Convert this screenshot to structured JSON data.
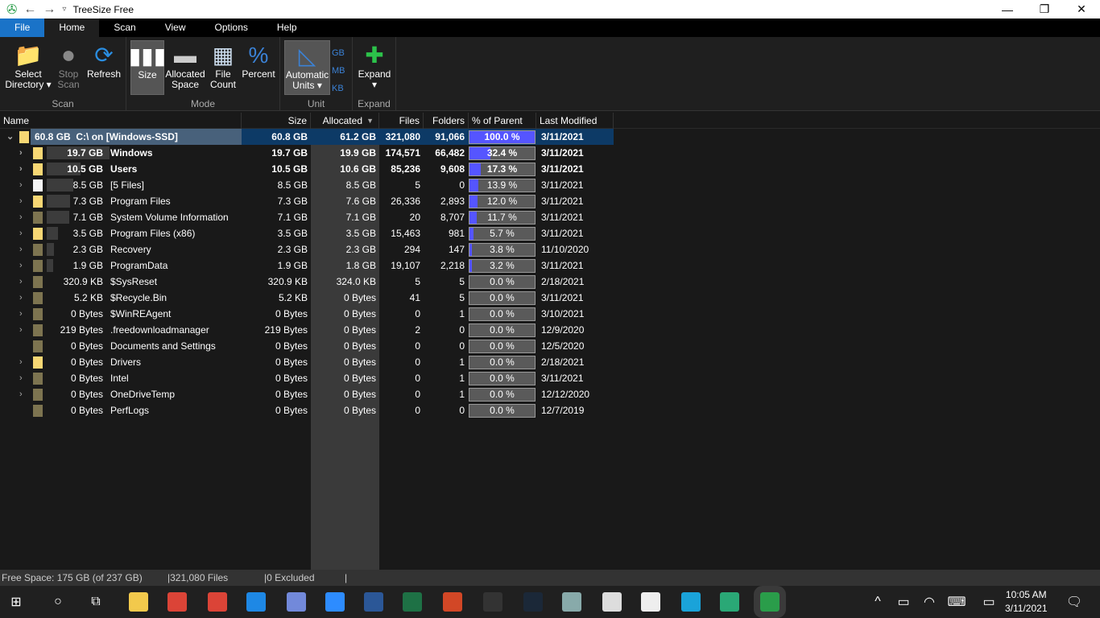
{
  "title": "TreeSize Free",
  "menu": [
    "File",
    "Home",
    "Scan",
    "View",
    "Options",
    "Help"
  ],
  "ribbon": {
    "select_directory": "Select Directory",
    "stop_scan": "Stop Scan",
    "refresh": "Refresh",
    "group_scan": "Scan",
    "size": "Size",
    "allocated_space": "Allocated Space",
    "file_count": "File Count",
    "percent": "Percent",
    "group_mode": "Mode",
    "automatic_units": "Automatic Units",
    "gb": "GB",
    "mb": "MB",
    "kb": "KB",
    "group_unit": "Unit",
    "expand": "Expand",
    "group_expand": "Expand"
  },
  "columns": {
    "name": "Name",
    "size": "Size",
    "allocated": "Allocated",
    "files": "Files",
    "folders": "Folders",
    "percent": "% of Parent ...",
    "modified": "Last Modified"
  },
  "rows": [
    {
      "label": "60.8 GB",
      "name": "C:\\  on  [Windows-SSD]",
      "size": "60.8 GB",
      "allocated": "61.2 GB",
      "files": "321,080",
      "folders": "91,066",
      "percent": "100.0 %",
      "pct": 100,
      "modified": "3/11/2021",
      "icon": "folder",
      "root": true,
      "bold": true
    },
    {
      "label": "19.7 GB",
      "name": "Windows",
      "size": "19.7 GB",
      "allocated": "19.9 GB",
      "files": "174,571",
      "folders": "66,482",
      "percent": "32.4 %",
      "pct": 32.4,
      "modified": "3/11/2021",
      "icon": "folder",
      "bold": true
    },
    {
      "label": "10.5 GB",
      "name": "Users",
      "size": "10.5 GB",
      "allocated": "10.6 GB",
      "files": "85,236",
      "folders": "9,608",
      "percent": "17.3 %",
      "pct": 17.3,
      "modified": "3/11/2021",
      "icon": "folder",
      "bold": true
    },
    {
      "label": "8.5 GB",
      "name": "[5 Files]",
      "size": "8.5 GB",
      "allocated": "8.5 GB",
      "files": "5",
      "folders": "0",
      "percent": "13.9 %",
      "pct": 13.9,
      "modified": "3/11/2021",
      "icon": "file"
    },
    {
      "label": "7.3 GB",
      "name": "Program Files",
      "size": "7.3 GB",
      "allocated": "7.6 GB",
      "files": "26,336",
      "folders": "2,893",
      "percent": "12.0 %",
      "pct": 12.0,
      "modified": "3/11/2021",
      "icon": "folder"
    },
    {
      "label": "7.1 GB",
      "name": "System Volume Information",
      "size": "7.1 GB",
      "allocated": "7.1 GB",
      "files": "20",
      "folders": "8,707",
      "percent": "11.7 %",
      "pct": 11.7,
      "modified": "3/11/2021",
      "icon": "hidden"
    },
    {
      "label": "3.5 GB",
      "name": "Program Files (x86)",
      "size": "3.5 GB",
      "allocated": "3.5 GB",
      "files": "15,463",
      "folders": "981",
      "percent": "5.7 %",
      "pct": 5.7,
      "modified": "3/11/2021",
      "icon": "folder"
    },
    {
      "label": "2.3 GB",
      "name": "Recovery",
      "size": "2.3 GB",
      "allocated": "2.3 GB",
      "files": "294",
      "folders": "147",
      "percent": "3.8 %",
      "pct": 3.8,
      "modified": "11/10/2020",
      "icon": "hidden"
    },
    {
      "label": "1.9 GB",
      "name": "ProgramData",
      "size": "1.9 GB",
      "allocated": "1.8 GB",
      "files": "19,107",
      "folders": "2,218",
      "percent": "3.2 %",
      "pct": 3.2,
      "modified": "3/11/2021",
      "icon": "hidden"
    },
    {
      "label": "320.9 KB",
      "name": "$SysReset",
      "size": "320.9 KB",
      "allocated": "324.0 KB",
      "files": "5",
      "folders": "5",
      "percent": "0.0 %",
      "pct": 0,
      "modified": "2/18/2021",
      "icon": "hidden"
    },
    {
      "label": "5.2 KB",
      "name": "$Recycle.Bin",
      "size": "5.2 KB",
      "allocated": "0 Bytes",
      "files": "41",
      "folders": "5",
      "percent": "0.0 %",
      "pct": 0,
      "modified": "3/11/2021",
      "icon": "hidden"
    },
    {
      "label": "0 Bytes",
      "name": "$WinREAgent",
      "size": "0 Bytes",
      "allocated": "0 Bytes",
      "files": "0",
      "folders": "1",
      "percent": "0.0 %",
      "pct": 0,
      "modified": "3/10/2021",
      "icon": "hidden"
    },
    {
      "label": "219 Bytes",
      "name": ".freedownloadmanager",
      "size": "219 Bytes",
      "allocated": "0 Bytes",
      "files": "2",
      "folders": "0",
      "percent": "0.0 %",
      "pct": 0,
      "modified": "12/9/2020",
      "icon": "hidden"
    },
    {
      "label": "0 Bytes",
      "name": "Documents and Settings",
      "size": "0 Bytes",
      "allocated": "0 Bytes",
      "files": "0",
      "folders": "0",
      "percent": "0.0 %",
      "pct": 0,
      "modified": "12/5/2020",
      "icon": "hidden",
      "noarrow": true
    },
    {
      "label": "0 Bytes",
      "name": "Drivers",
      "size": "0 Bytes",
      "allocated": "0 Bytes",
      "files": "0",
      "folders": "1",
      "percent": "0.0 %",
      "pct": 0,
      "modified": "2/18/2021",
      "icon": "folder"
    },
    {
      "label": "0 Bytes",
      "name": "Intel",
      "size": "0 Bytes",
      "allocated": "0 Bytes",
      "files": "0",
      "folders": "1",
      "percent": "0.0 %",
      "pct": 0,
      "modified": "3/11/2021",
      "icon": "hidden"
    },
    {
      "label": "0 Bytes",
      "name": "OneDriveTemp",
      "size": "0 Bytes",
      "allocated": "0 Bytes",
      "files": "0",
      "folders": "1",
      "percent": "0.0 %",
      "pct": 0,
      "modified": "12/12/2020",
      "icon": "hidden"
    },
    {
      "label": "0 Bytes",
      "name": "PerfLogs",
      "size": "0 Bytes",
      "allocated": "0 Bytes",
      "files": "0",
      "folders": "0",
      "percent": "0.0 %",
      "pct": 0,
      "modified": "12/7/2019",
      "icon": "hidden",
      "noarrow": true
    }
  ],
  "status": {
    "free": "Free Space: 175 GB  (of 237 GB)",
    "files": "321,080 Files",
    "excluded": "0 Excluded"
  },
  "taskbar": {
    "time": "10:05 AM",
    "date": "3/11/2021",
    "apps": [
      "file-explorer",
      "chrome",
      "chrome",
      "vscode",
      "discord",
      "zoom",
      "word",
      "excel",
      "powerpoint",
      "epic-games",
      "steam",
      "osu",
      "settings",
      "xbox",
      "libby",
      "edge",
      "treesize"
    ]
  }
}
